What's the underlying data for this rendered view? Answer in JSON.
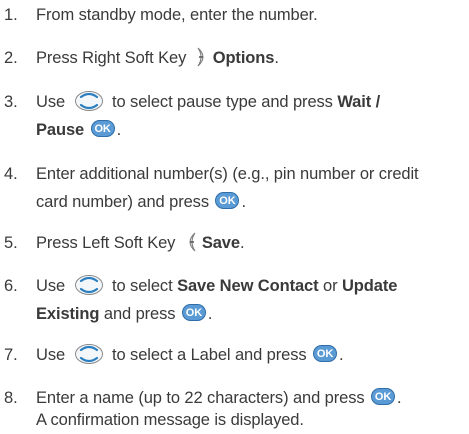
{
  "steps": [
    {
      "num": "1.",
      "t1": "From standby mode, enter the number."
    },
    {
      "num": "2.",
      "t1": "Press Right Soft Key ",
      "b1": "Options",
      "t2": "."
    },
    {
      "num": "3.",
      "t1": "Use ",
      "t2": " to select pause type and press ",
      "b1": "Wait /",
      "b2": "Pause",
      "ok": "OK",
      "t3": "."
    },
    {
      "num": "4.",
      "t1": "Enter additional number(s) (e.g., pin number or credit",
      "t2": "card number) and press ",
      "ok": "OK",
      "t3": "."
    },
    {
      "num": "5.",
      "t1": "Press Left Soft Key ",
      "b1": "Save",
      "t2": "."
    },
    {
      "num": "6.",
      "t1": "Use ",
      "t2": " to select ",
      "b1": "Save New Contact",
      "t3": " or ",
      "b2": "Update",
      "b3": "Existing",
      "t4": " and press ",
      "ok": "OK",
      "t5": "."
    },
    {
      "num": "7.",
      "t1": "Use ",
      "t2": " to select a Label and press ",
      "ok": "OK",
      "t3": "."
    },
    {
      "num": "8.",
      "t1": "Enter a name (up to 22 characters) and press ",
      "ok": "OK",
      "t2": ".",
      "t3": "A confirmation message is displayed."
    }
  ],
  "colors": {
    "ok_key": "#5b9bd5",
    "nav_key": "#2a7fc0",
    "text": "#3a3a3a"
  },
  "icons": {
    "nav": "navigation-key-icon",
    "ok": "ok-key-icon",
    "right_soft": "right-soft-key-icon",
    "left_soft": "left-soft-key-icon"
  }
}
